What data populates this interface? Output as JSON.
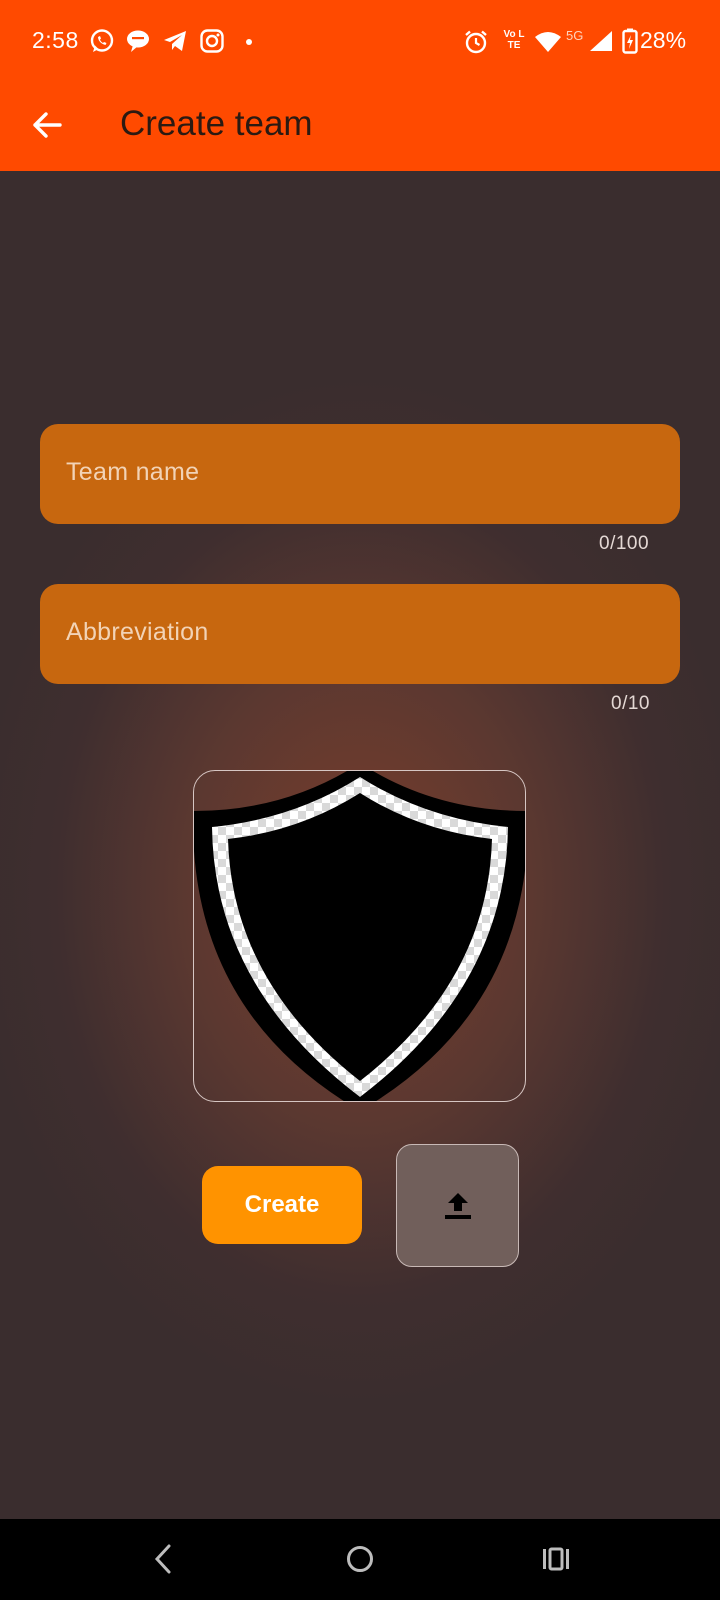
{
  "status_bar": {
    "time": "2:58",
    "notifications": [
      "whatsapp-icon",
      "chat-icon",
      "telegram-icon",
      "instagram-icon"
    ],
    "network_label": "5G",
    "volte_label": "Vo LTE",
    "battery": "28%"
  },
  "app_bar": {
    "title": "Create team",
    "back_icon": "arrow-back-icon"
  },
  "form": {
    "team_name": {
      "value": "",
      "placeholder": "Team name",
      "counter": "0/100"
    },
    "abbreviation": {
      "value": "",
      "placeholder": "Abbreviation",
      "counter": "0/10"
    }
  },
  "logo": {
    "icon": "shield-icon"
  },
  "buttons": {
    "create_label": "Create",
    "upload_icon": "upload-icon"
  },
  "nav_bar": [
    "back-nav-icon",
    "home-nav-icon",
    "recents-nav-icon"
  ],
  "colors": {
    "app_bar": "#ff4a00",
    "field_fill": "#c7670f",
    "create_button": "#ff9300",
    "upload_button": "#715f5b",
    "background": "#3a2d2e"
  }
}
